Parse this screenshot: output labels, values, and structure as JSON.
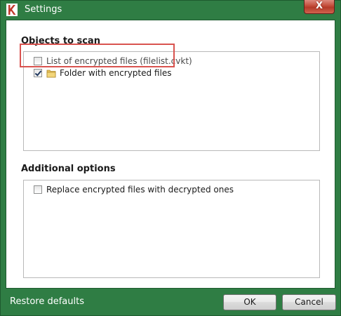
{
  "window": {
    "title": "Settings",
    "close_label": "X"
  },
  "objects_section": {
    "heading": "Objects to scan",
    "items": [
      {
        "label": "List of encrypted files (filelist.cvkt)",
        "checked": false
      },
      {
        "label": "Folder with encrypted files",
        "checked": true
      }
    ]
  },
  "options_section": {
    "heading": "Additional options",
    "items": [
      {
        "label": "Replace encrypted files with decrypted ones",
        "checked": false
      }
    ]
  },
  "footer": {
    "restore_label": "Restore defaults",
    "ok_label": "OK",
    "cancel_label": "Cancel"
  },
  "icons": {
    "app": "kaspersky-logo-icon",
    "close": "close-icon",
    "folder": "folder-icon",
    "checkbox": "checkbox-icon"
  },
  "colors": {
    "frame": "#2f7d44",
    "highlight": "#d9534f",
    "close_button": "#c24a38"
  }
}
